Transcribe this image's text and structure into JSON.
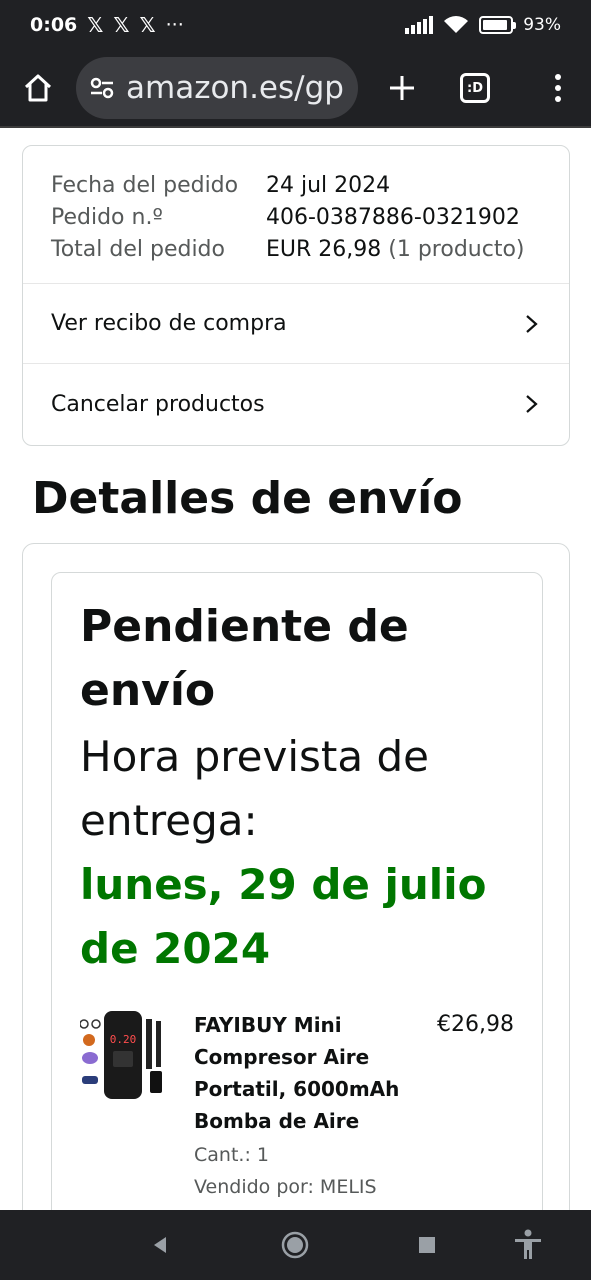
{
  "status_bar": {
    "time": "0:06",
    "notification_icons": [
      "x-icon",
      "x-icon",
      "x-icon"
    ],
    "more": "···",
    "battery": "93%",
    "battery_level": 0.93
  },
  "browser": {
    "url": "amazon.es/gp"
  },
  "order_summary": {
    "rows": [
      {
        "label": "Fecha del pedido",
        "value": "24 jul 2024",
        "muted": ""
      },
      {
        "label": "Pedido n.º",
        "value": "406-0387886-0321902",
        "muted": ""
      },
      {
        "label": "Total del pedido",
        "value": "EUR 26,98",
        "muted": "(1 producto)"
      }
    ],
    "links": [
      {
        "label": "Ver recibo de compra"
      },
      {
        "label": "Cancelar productos"
      }
    ]
  },
  "shipping": {
    "section_title": "Detalles de envío",
    "status": "Pendiente de envío",
    "eta_label": "Hora prevista de entrega:",
    "eta_date": "lunes, 29 de julio de 2024",
    "product": {
      "name": "FAYIBUY Mini Compresor Aire Portatil, 6000mAh Bomba de Aire",
      "quantity": "Cant.: 1",
      "seller": "Vendido por: MELIS ERLEY LTD",
      "price": "€26,98",
      "image_display": "0.20"
    }
  },
  "colors": {
    "eta": "#007600",
    "system_bar": "#202124"
  }
}
